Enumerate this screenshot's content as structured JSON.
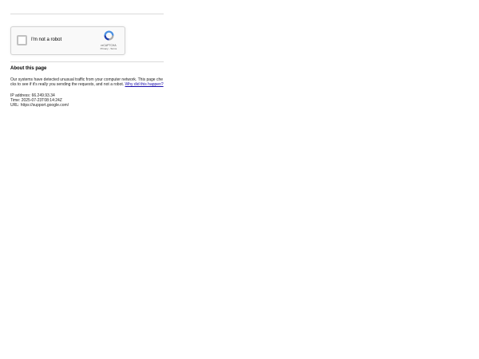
{
  "captcha": {
    "label": "I'm not a robot",
    "brand": "reCAPTCHA",
    "privacy": "Privacy",
    "separator": " - ",
    "terms": "Terms"
  },
  "about": {
    "heading": "About this page",
    "paragraph": "Our systems have detected unusual traffic from your computer network. This page checks to see if it's really you sending the requests, and not a robot.",
    "why_link": "Why did this happen?",
    "ip_line": "IP address: 66.249.93.34",
    "time_line": "Time: 2025-07-23T08:14:24Z",
    "url_line": "URL: https://support.google.com/"
  },
  "colors": {
    "link": "#1a0dab",
    "recaptcha_blue": "#1c3aa9",
    "recaptcha_light_blue": "#4a90e2",
    "recaptcha_grey": "#ababab"
  },
  "icons": {
    "captcha_logo": "recaptcha-logo-icon"
  }
}
